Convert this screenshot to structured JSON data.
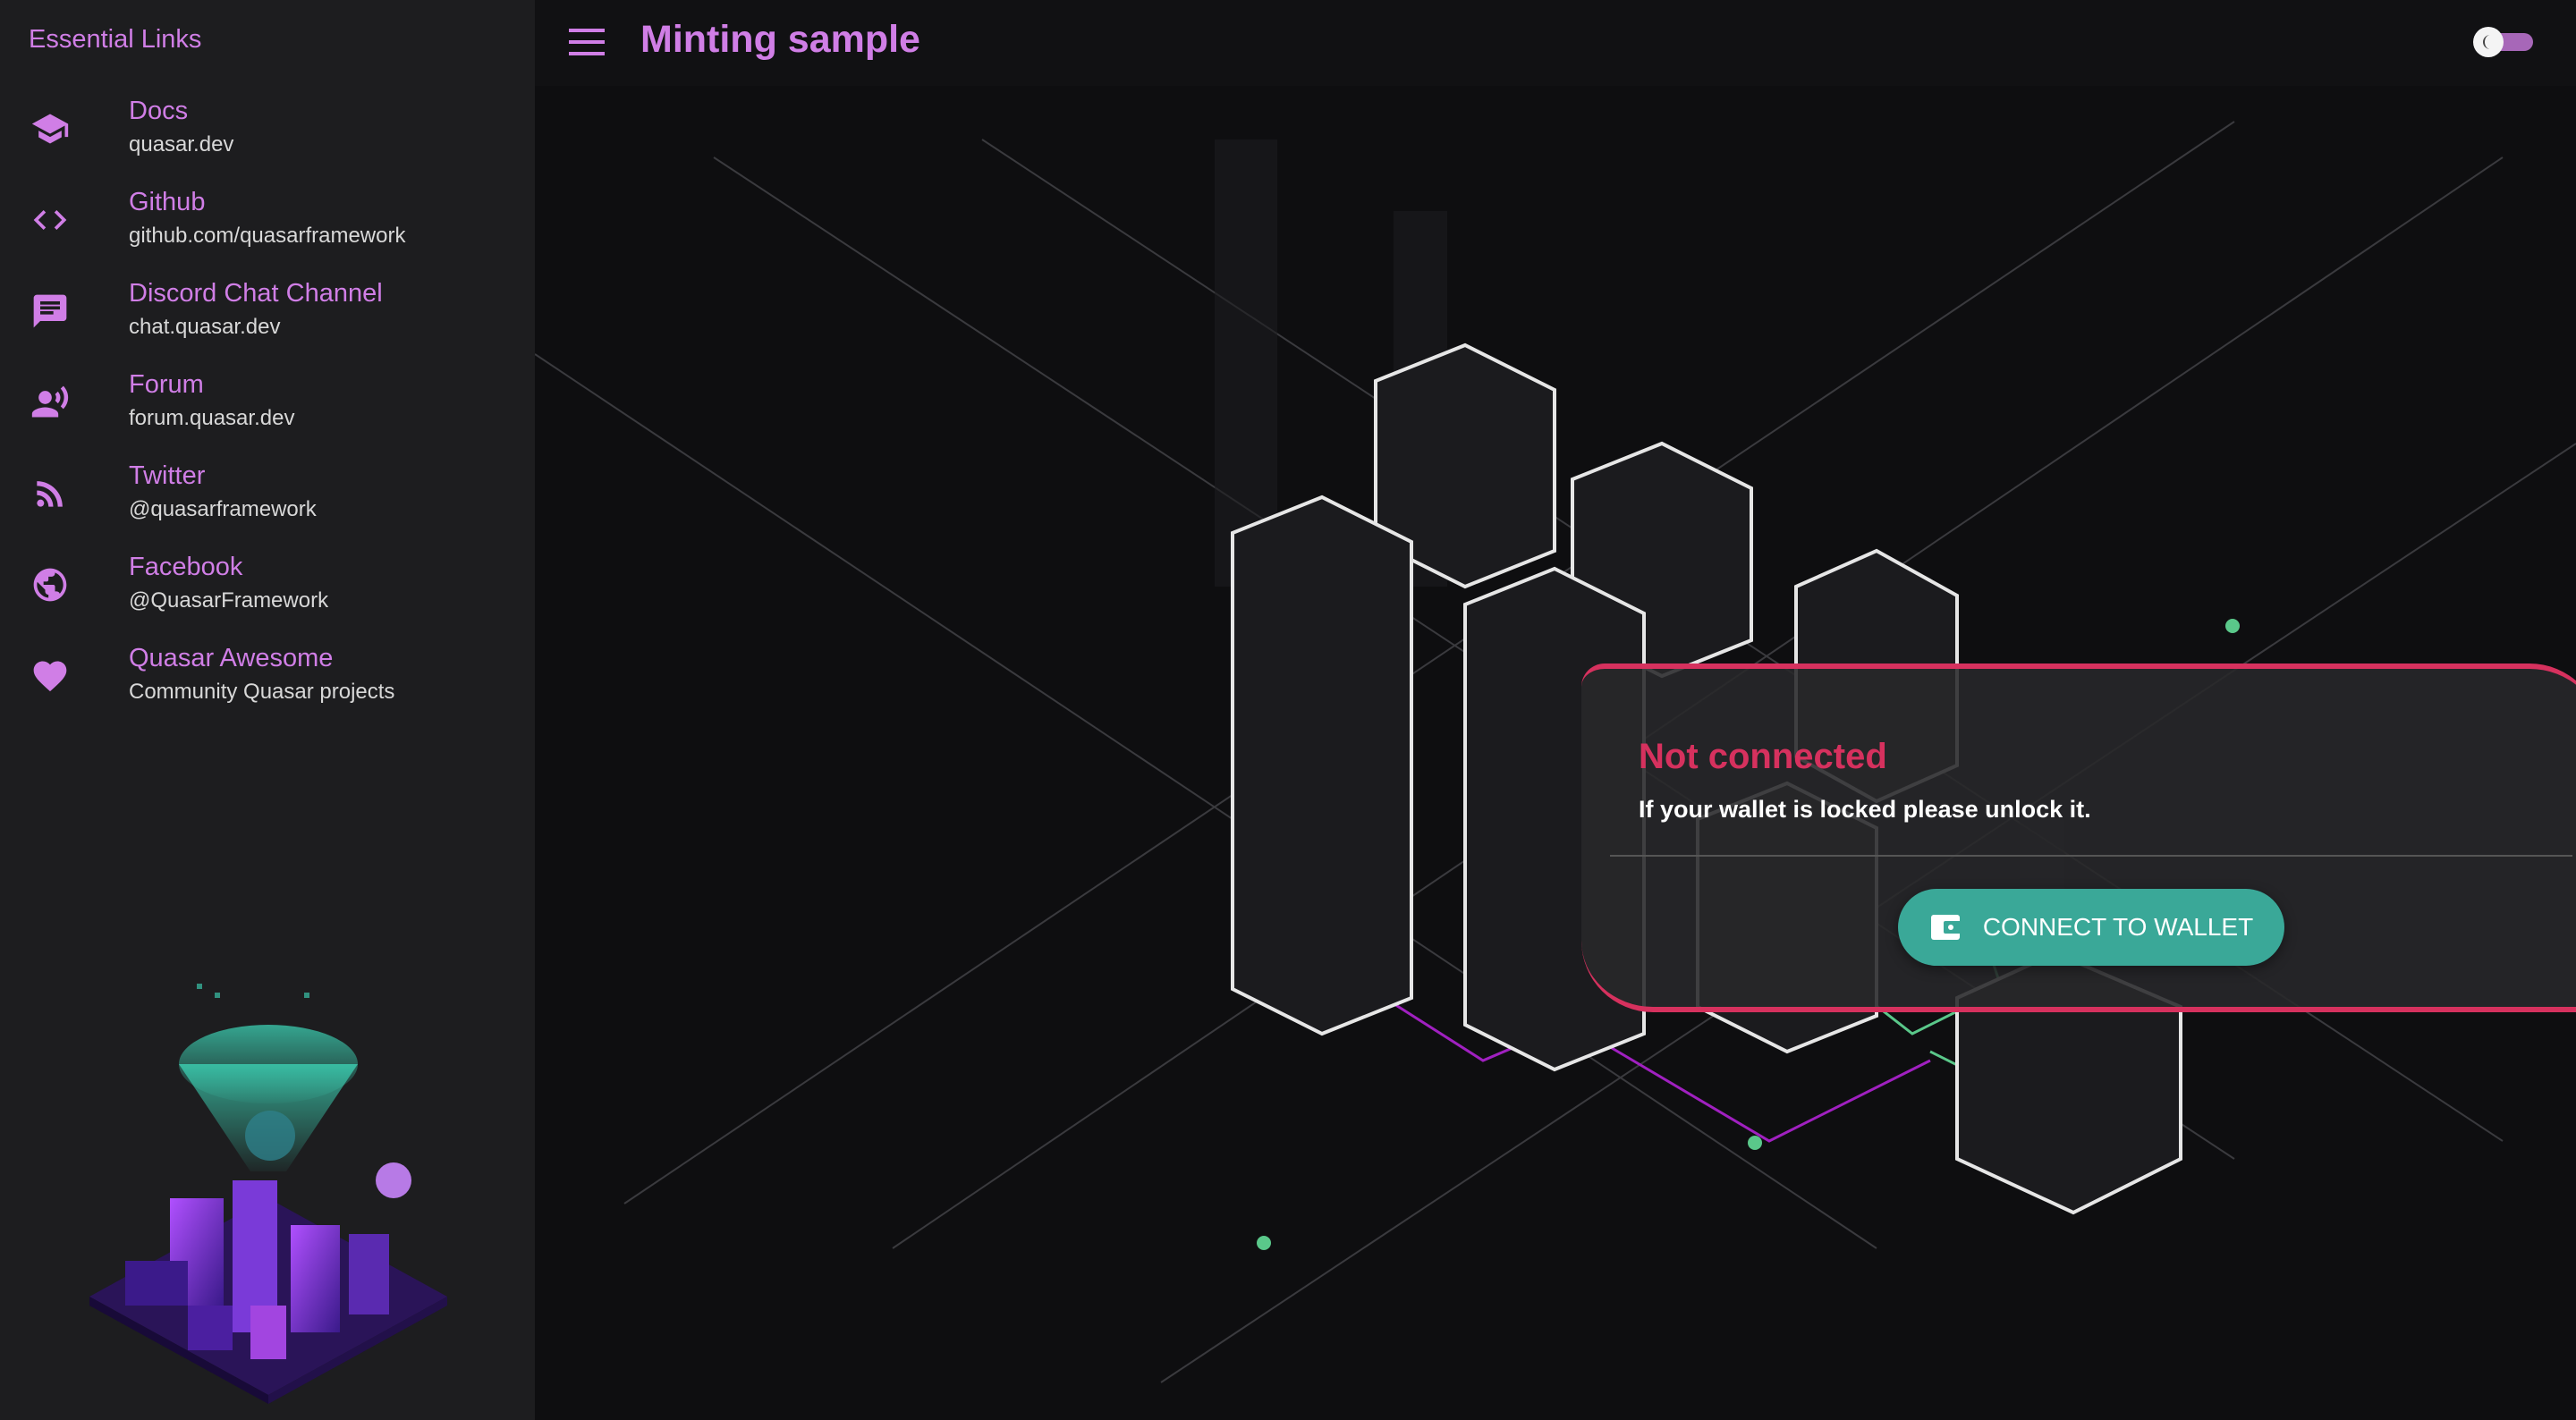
{
  "sidebar": {
    "header": "Essential Links",
    "items": [
      {
        "label": "Docs",
        "caption": "quasar.dev",
        "icon": "school-icon"
      },
      {
        "label": "Github",
        "caption": "github.com/quasarframework",
        "icon": "code-icon"
      },
      {
        "label": "Discord Chat Channel",
        "caption": "chat.quasar.dev",
        "icon": "chat-icon"
      },
      {
        "label": "Forum",
        "caption": "forum.quasar.dev",
        "icon": "record-voice-icon"
      },
      {
        "label": "Twitter",
        "caption": "@quasarframework",
        "icon": "rss-feed-icon"
      },
      {
        "label": "Facebook",
        "caption": "@QuasarFramework",
        "icon": "public-icon"
      },
      {
        "label": "Quasar Awesome",
        "caption": "Community Quasar projects",
        "icon": "favorite-icon"
      }
    ]
  },
  "header": {
    "title": "Minting sample"
  },
  "card": {
    "title": "Not connected",
    "text": "If your wallet is locked please unlock it.",
    "button_label": "CONNECT TO WALLET"
  },
  "theme_toggle": {
    "state": "dark"
  },
  "colors": {
    "accent": "#d07ee6",
    "danger": "#d6315e",
    "teal": "#3aa898",
    "background": "#0e0e10",
    "sidebar": "#1d1d1f"
  }
}
